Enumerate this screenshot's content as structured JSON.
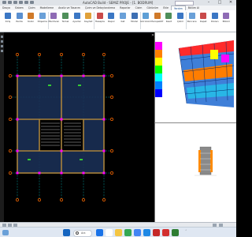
{
  "window": {
    "title": "AutoCAD Build - SEMIZ PROJE - [1. BODRUM]",
    "search_placeholder": "",
    "controls": [
      "–",
      "□",
      "✕"
    ]
  },
  "ribbon": {
    "tabs": [
      "Dosya",
      "Sistem",
      "Çizim",
      "Modelleme",
      "Analiz ve Tasarım",
      "Çizim ve Detaylandırma",
      "Raporlar",
      "Cizim",
      "Görünüm",
      "Ekle",
      "Yardım",
      "Bölüm Al"
    ],
    "active_tab": 10,
    "tools": [
      {
        "label": "Kiriş",
        "icon": "beam-icon",
        "color": "#3b77c4"
      },
      {
        "label": "Perde",
        "icon": "wall-icon",
        "color": "#5a8fd0"
      },
      {
        "label": "Kolon",
        "icon": "column-icon",
        "color": "#d07a2a"
      },
      {
        "label": "Döşeme",
        "icon": "slab-icon",
        "color": "#6aa0d8"
      },
      {
        "label": "Merdiven",
        "icon": "stair-icon",
        "color": "#8f6bb5"
      },
      {
        "label": "Temel",
        "icon": "foundation-icon",
        "color": "#4f8f5a"
      },
      {
        "label": "Ayarlar",
        "icon": "settings-icon",
        "color": "#3b77c4"
      },
      {
        "label": "Kaydet",
        "icon": "save-icon",
        "color": "#e0a13a"
      },
      {
        "label": "Hesapla",
        "icon": "calculate-icon",
        "color": "#c94a4a"
      },
      {
        "label": "Rapor",
        "icon": "report-icon",
        "color": "#3b77c4"
      },
      {
        "label": "Kat",
        "icon": "floor-icon",
        "color": "#6aa0d8"
      },
      {
        "label": "Model",
        "icon": "model-icon",
        "color": "#3d6fb3"
      },
      {
        "label": "Görünüm",
        "icon": "view-icon",
        "color": "#5e9fd6"
      },
      {
        "label": "Perspektif",
        "icon": "perspective-icon",
        "color": "#d07a2a"
      },
      {
        "label": "Kesit",
        "icon": "section-icon",
        "color": "#4f8f5a"
      },
      {
        "label": "Çizim",
        "icon": "draw-icon",
        "color": "#3b77c4"
      },
      {
        "label": "Pencere",
        "icon": "window-icon",
        "color": "#6aa0d8"
      },
      {
        "label": "Kapat",
        "icon": "close-view-icon",
        "color": "#c94a4a"
      },
      {
        "label": "Düzen",
        "icon": "layout-icon",
        "color": "#3b77c4"
      },
      {
        "label": "Bölüm",
        "icon": "split-icon",
        "color": "#8f6bb5"
      }
    ]
  },
  "views": {
    "legend_colors": [
      "#ff00ff",
      "#ff8000",
      "#ffff00",
      "#00ff00",
      "#00ffff",
      "#0080ff",
      "#0000ff"
    ],
    "legend_values": [
      "",
      "",
      "",
      "",
      "",
      "",
      ""
    ]
  },
  "taskbar": {
    "search_label": "Ara",
    "apps": [
      {
        "icon": "windows-start-icon",
        "color": "#1a73e8"
      },
      {
        "icon": "search-icon",
        "color": "#ffffff"
      },
      {
        "icon": "file-explorer-icon",
        "color": "#f4c542"
      },
      {
        "icon": "browser-icon",
        "color": "#34a853"
      },
      {
        "icon": "store-icon",
        "color": "#4285f4"
      },
      {
        "icon": "mail-icon",
        "color": "#1e88e5"
      },
      {
        "icon": "autocad-icon",
        "color": "#c62828"
      },
      {
        "icon": "pdf-icon",
        "color": "#d32f2f"
      },
      {
        "icon": "excel-icon",
        "color": "#2e7d32"
      },
      {
        "icon": "word-icon",
        "color": "#1565c0"
      }
    ],
    "time": "",
    "date": ""
  },
  "colors": {
    "grid_axis": "#00c8c8",
    "axis_bubble": "#ff6a00",
    "wall": "#a8823c",
    "column": "#ff00ff",
    "slab": "#1a2f55"
  }
}
